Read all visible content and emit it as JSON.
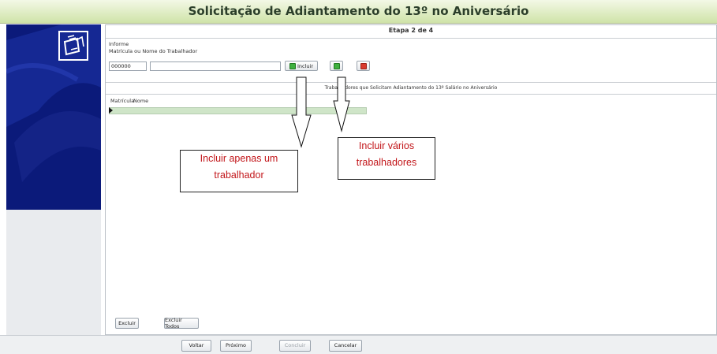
{
  "window": {
    "title": "Solicitação de Adiantamento do 13º no Aniversário"
  },
  "step": {
    "label": "Etapa 2 de 4"
  },
  "form": {
    "section_label": "Informe",
    "field_label": "Matrícula ou Nome do Trabalhador",
    "matricula_value": "000000",
    "name_value": "",
    "include_label": "Incluir"
  },
  "grid": {
    "caption": "Trabalhadores que Solicitam Adiantamento do 13º Salário no Aniversário",
    "columns": [
      "Matrícula",
      "Nome"
    ]
  },
  "actions": {
    "delete_label": "Excluir",
    "delete_all_label": "Excluir Todos"
  },
  "footer": {
    "back": "Voltar",
    "next": "Próximo",
    "finish": "Concluir",
    "cancel": "Cancelar"
  },
  "annotations": {
    "single": [
      "Incluir apenas um",
      "trabalhador"
    ],
    "multiple": [
      "Incluir vários",
      "trabalhadores"
    ]
  },
  "colors": {
    "brand_panel": "#0b1a7a",
    "callout_text": "#c2161a",
    "include_icon": "#3fb13f",
    "remove_icon": "#d93a2e"
  }
}
